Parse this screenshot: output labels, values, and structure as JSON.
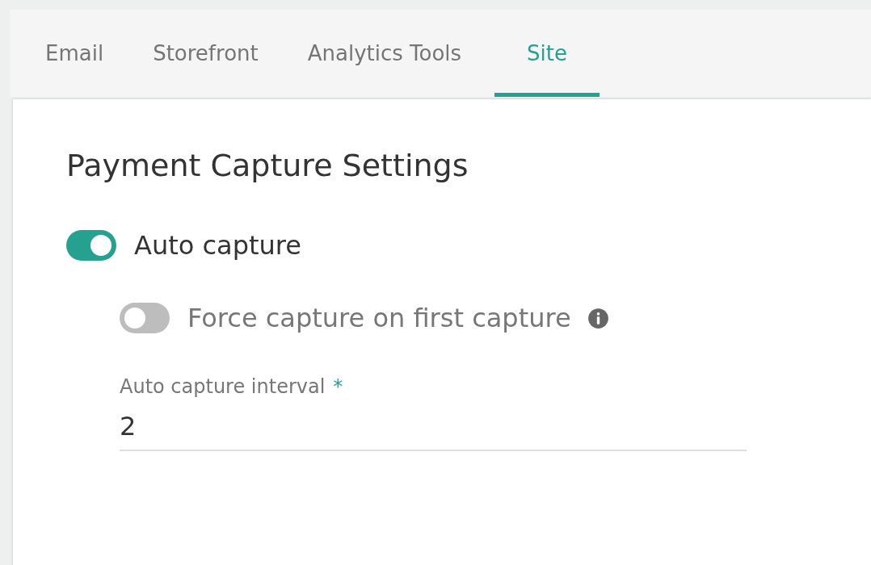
{
  "tabs": [
    {
      "label": "Email",
      "selected": false
    },
    {
      "label": "Storefront",
      "selected": false
    },
    {
      "label": "Analytics Tools",
      "selected": false
    },
    {
      "label": "Site",
      "selected": true
    }
  ],
  "card": {
    "title": "Payment Capture Settings",
    "toggles": [
      {
        "kind": "main",
        "label": "Auto capture",
        "on": true,
        "disabled": false
      },
      {
        "kind": "sub",
        "label": "Force capture on first capture",
        "on": false,
        "disabled": true
      }
    ],
    "field": {
      "label": "Auto capture interval",
      "required_mark": "*",
      "value": "2"
    }
  }
}
